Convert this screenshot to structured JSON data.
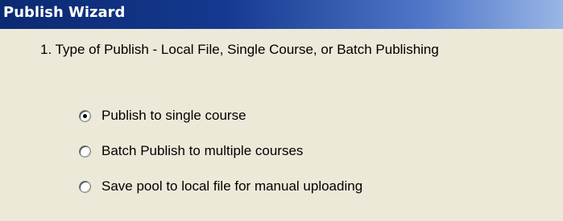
{
  "window": {
    "title": "Publish Wizard"
  },
  "step": {
    "heading": "1.  Type of Publish - Local File, Single Course, or Batch Publishing"
  },
  "options": [
    {
      "label": "Publish to single course",
      "selected": true
    },
    {
      "label": "Batch Publish to multiple courses",
      "selected": false
    },
    {
      "label": "Save pool to local file for manual uploading",
      "selected": false
    }
  ],
  "colors": {
    "titlebar_dark": "#0c2a72",
    "titlebar_light": "#9ab6e6",
    "background": "#ece9d8"
  }
}
